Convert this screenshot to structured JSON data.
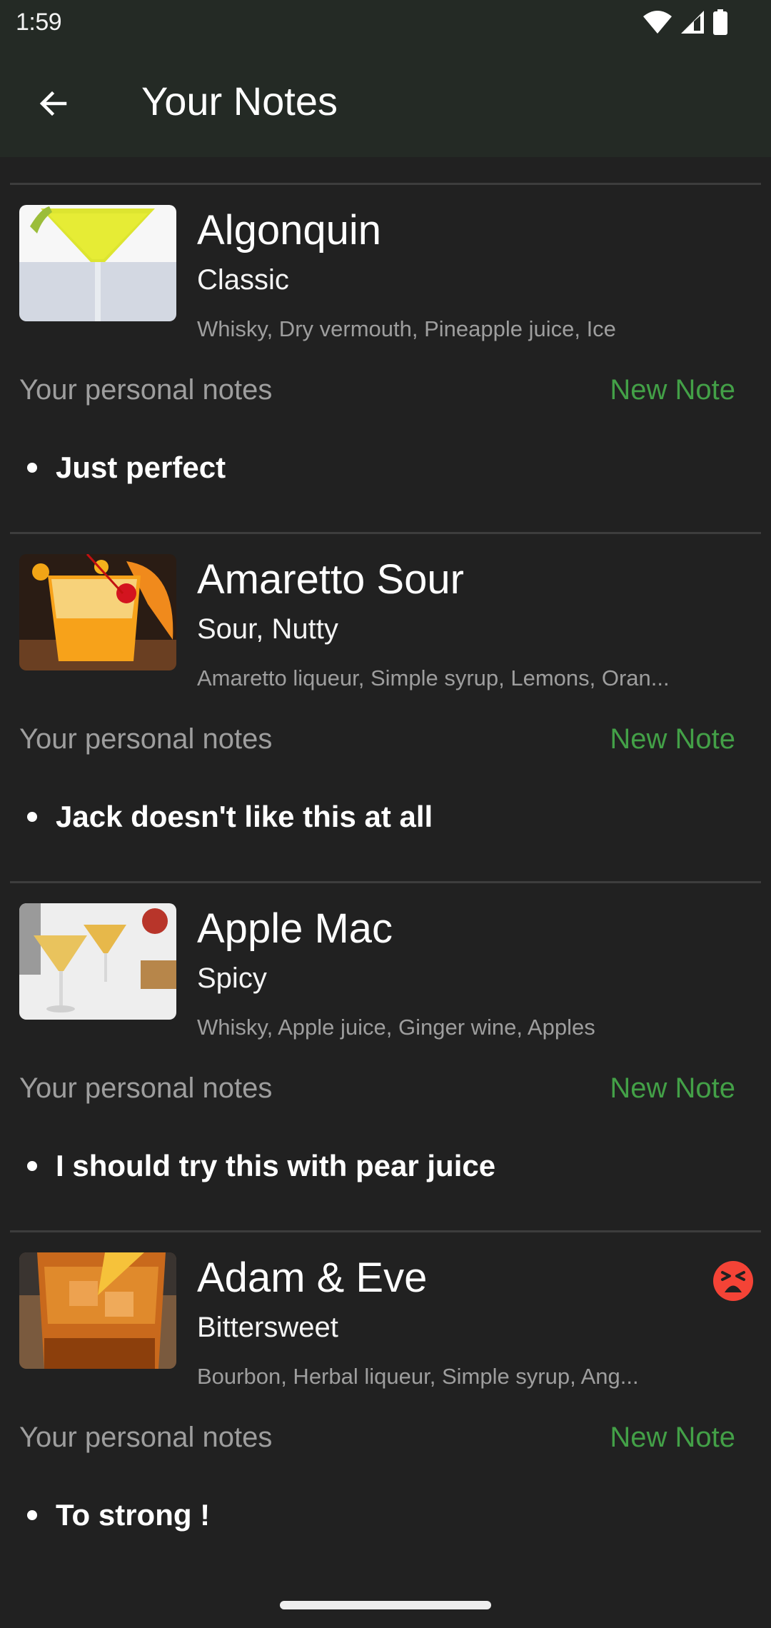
{
  "status_bar": {
    "time": "1:59",
    "icons": [
      "wifi-icon",
      "cellular-signal-icon",
      "battery-icon"
    ]
  },
  "app_bar": {
    "back_icon": "arrow-back-icon",
    "title": "Your Notes"
  },
  "colors": {
    "app_bar_bg": "#242a25",
    "background": "#212121",
    "accent_green": "#43a047",
    "muted_text": "#9e9e9e",
    "angry_red": "#f44336"
  },
  "cocktails": [
    {
      "name": "Algonquin",
      "category": "Classic",
      "ingredients": "Whisky, Dry vermouth, Pineapple juice, Ice",
      "image": "yellow martini cocktail",
      "notes_label": "Your personal notes",
      "new_note_label": "New Note",
      "notes": [
        "Just perfect"
      ],
      "rating_icon": null
    },
    {
      "name": "Amaretto Sour",
      "category": "Sour, Nutty",
      "ingredients": "Amaretto liqueur, Simple syrup, Lemons, Oran...",
      "image": "orange amaretto sour on ice",
      "notes_label": "Your personal notes",
      "new_note_label": "New Note",
      "notes": [
        "Jack doesn't like this at all"
      ],
      "rating_icon": null
    },
    {
      "name": "Apple Mac",
      "category": "Spicy",
      "ingredients": "Whisky, Apple juice, Ginger wine, Apples",
      "image": "two apple cocktails in coupe glasses",
      "notes_label": "Your personal notes",
      "new_note_label": "New Note",
      "notes": [
        "I should try this with pear juice"
      ],
      "rating_icon": null
    },
    {
      "name": "Adam & Eve",
      "category": "Bittersweet",
      "ingredients": "Bourbon, Herbal liqueur, Simple syrup, Ang...",
      "image": "amber bourbon cocktail on ice",
      "notes_label": "Your personal notes",
      "new_note_label": "New Note",
      "notes": [
        "To strong !"
      ],
      "rating_icon": "angry-face-icon"
    }
  ]
}
